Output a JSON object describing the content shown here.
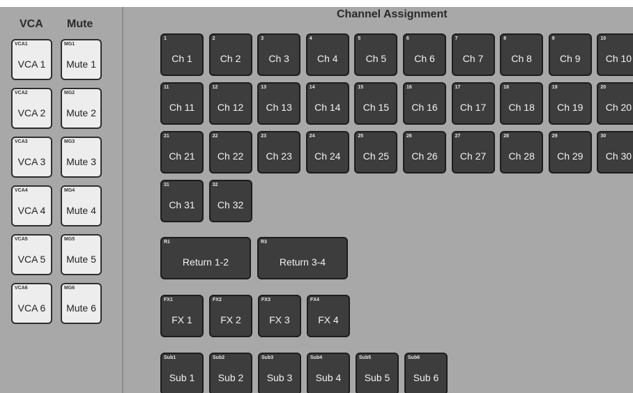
{
  "left": {
    "headers": {
      "vca": "VCA",
      "mute": "Mute"
    },
    "vca": [
      {
        "tag": "VCA1",
        "label": "VCA 1"
      },
      {
        "tag": "VCA2",
        "label": "VCA 2"
      },
      {
        "tag": "VCA3",
        "label": "VCA 3"
      },
      {
        "tag": "VCA4",
        "label": "VCA 4"
      },
      {
        "tag": "VCA5",
        "label": "VCA 5"
      },
      {
        "tag": "VCA6",
        "label": "VCA 6"
      }
    ],
    "mute": [
      {
        "tag": "MG1",
        "label": "Mute 1"
      },
      {
        "tag": "MG2",
        "label": "Mute 2"
      },
      {
        "tag": "MG3",
        "label": "Mute 3"
      },
      {
        "tag": "MG4",
        "label": "Mute 4"
      },
      {
        "tag": "MG5",
        "label": "Mute 5"
      },
      {
        "tag": "MG6",
        "label": "Mute 6"
      }
    ]
  },
  "right": {
    "title": "Channel Assignment",
    "channels": [
      {
        "tag": "1",
        "label": "Ch 1"
      },
      {
        "tag": "2",
        "label": "Ch 2"
      },
      {
        "tag": "3",
        "label": "Ch 3"
      },
      {
        "tag": "4",
        "label": "Ch 4"
      },
      {
        "tag": "5",
        "label": "Ch 5"
      },
      {
        "tag": "6",
        "label": "Ch 6"
      },
      {
        "tag": "7",
        "label": "Ch 7"
      },
      {
        "tag": "8",
        "label": "Ch 8"
      },
      {
        "tag": "9",
        "label": "Ch 9"
      },
      {
        "tag": "10",
        "label": "Ch 10"
      },
      {
        "tag": "11",
        "label": "Ch 11"
      },
      {
        "tag": "12",
        "label": "Ch 12"
      },
      {
        "tag": "13",
        "label": "Ch 13"
      },
      {
        "tag": "14",
        "label": "Ch 14"
      },
      {
        "tag": "15",
        "label": "Ch 15"
      },
      {
        "tag": "16",
        "label": "Ch 16"
      },
      {
        "tag": "17",
        "label": "Ch 17"
      },
      {
        "tag": "18",
        "label": "Ch 18"
      },
      {
        "tag": "19",
        "label": "Ch 19"
      },
      {
        "tag": "20",
        "label": "Ch 20"
      },
      {
        "tag": "21",
        "label": "Ch 21"
      },
      {
        "tag": "22",
        "label": "Ch 22"
      },
      {
        "tag": "23",
        "label": "Ch 23"
      },
      {
        "tag": "24",
        "label": "Ch 24"
      },
      {
        "tag": "25",
        "label": "Ch 25"
      },
      {
        "tag": "26",
        "label": "Ch 26"
      },
      {
        "tag": "27",
        "label": "Ch 27"
      },
      {
        "tag": "28",
        "label": "Ch 28"
      },
      {
        "tag": "29",
        "label": "Ch 29"
      },
      {
        "tag": "30",
        "label": "Ch 30"
      },
      {
        "tag": "31",
        "label": "Ch 31"
      },
      {
        "tag": "32",
        "label": "Ch 32"
      }
    ],
    "returns": [
      {
        "tag": "R1",
        "label": "Return 1-2"
      },
      {
        "tag": "R3",
        "label": "Return 3-4"
      }
    ],
    "fx": [
      {
        "tag": "FX1",
        "label": "FX 1"
      },
      {
        "tag": "FX2",
        "label": "FX 2"
      },
      {
        "tag": "FX3",
        "label": "FX 3"
      },
      {
        "tag": "FX4",
        "label": "FX 4"
      }
    ],
    "subs": [
      {
        "tag": "Sub1",
        "label": "Sub 1"
      },
      {
        "tag": "Sub2",
        "label": "Sub 2"
      },
      {
        "tag": "Sub3",
        "label": "Sub 3"
      },
      {
        "tag": "Sub4",
        "label": "Sub 4"
      },
      {
        "tag": "Sub5",
        "label": "Sub 5"
      },
      {
        "tag": "Sub6",
        "label": "Sub 6"
      }
    ]
  }
}
